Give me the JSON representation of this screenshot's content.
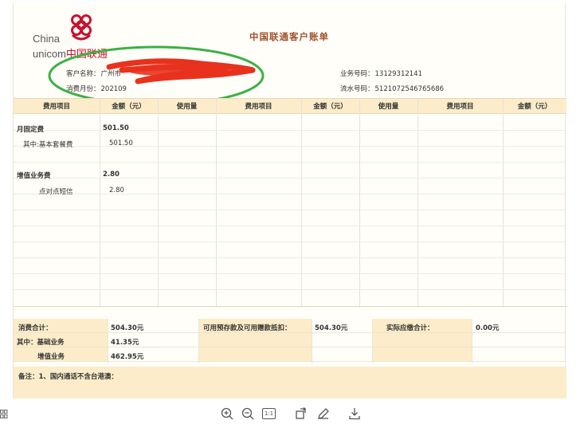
{
  "bill": {
    "title": "中国联通客户账单",
    "logo": {
      "en_line1": "China",
      "en_line2_a": "unicom",
      "en_line2_b": "中国联通"
    },
    "customer_name_label": "客户名称：",
    "customer_name_value": "广州市",
    "billing_month_label": "消费月份：",
    "billing_month_value": "202109",
    "service_number_label": "业务号码：",
    "service_number_value": "13129312141",
    "serial_number_label": "流水号码：",
    "serial_number_value": "5121072546765686"
  },
  "table": {
    "headers": [
      "费用项目",
      "金额（元）",
      "使用量",
      "费用项目",
      "金额（元）",
      "使用量",
      "费用项目",
      "金额（元）"
    ],
    "rows": [
      {
        "item": "月固定费",
        "amount": "501.50",
        "bold": true
      },
      {
        "item": "其中:基本套餐费",
        "amount": "501.50",
        "bold": false
      },
      {
        "item": "增值业务费",
        "amount": "2.80",
        "bold": true
      },
      {
        "item": "点对点短信",
        "amount": "2.80",
        "bold": false
      }
    ]
  },
  "summary": {
    "total_label": "消费合计：",
    "total_value": "504.30元",
    "prepaid_label": "可用预存款及可用赠款抵扣：",
    "prepaid_value": "504.30元",
    "due_label": "实际应缴合计：",
    "due_value": "0.00元",
    "basic_label": "其中：基础业务",
    "basic_value": "41.35元",
    "vas_label": "增值业务",
    "vas_value": "462.95元",
    "remark": "备注：1、国内通话不含台港澳："
  },
  "colors": {
    "header_bg": "#fcecc9",
    "title": "#a0522d",
    "circle": "#3cb043",
    "redaction": "#e8321e",
    "brand": "#c8102e"
  },
  "toolbar": {
    "icons": [
      "grid-icon",
      "zoom-in-icon",
      "zoom-out-icon",
      "actual-size-icon",
      "rotate-icon",
      "edit-icon",
      "download-icon"
    ],
    "actual_size_label": "1:1"
  }
}
